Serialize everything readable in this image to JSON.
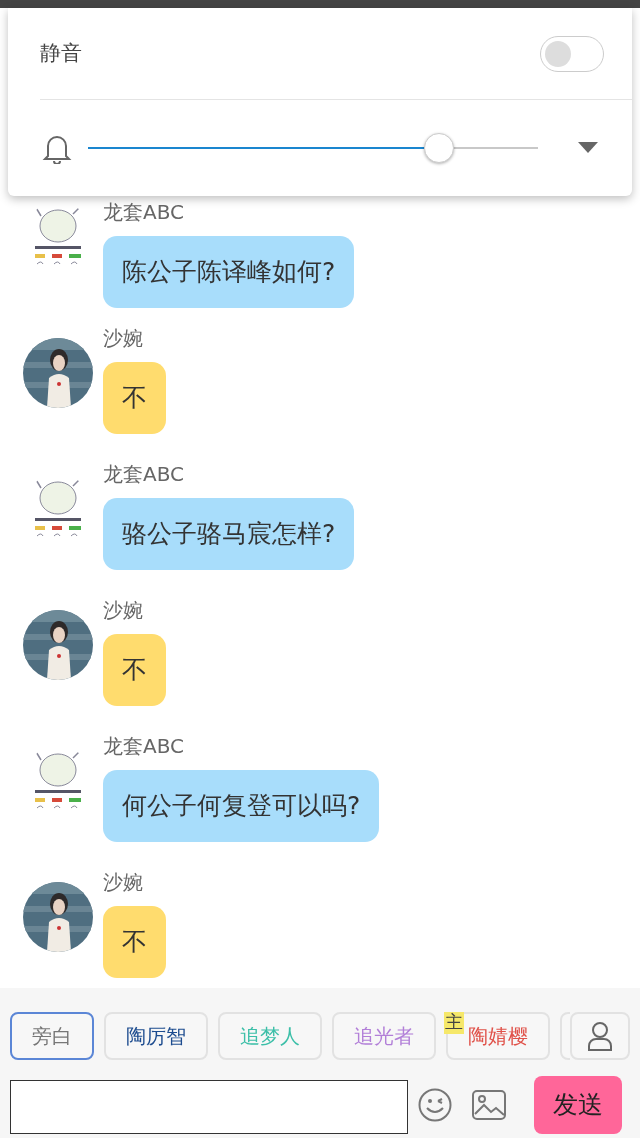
{
  "volume_panel": {
    "mute_label": "静音",
    "mute_on": false,
    "level": 0.78
  },
  "messages": [
    {
      "sender": "龙套ABC",
      "kind": "sketch",
      "text": "陈公子陈译峰如何?",
      "color": "#a8ddfb"
    },
    {
      "sender": "沙婉",
      "text": "不",
      "color": "#ffdc6e"
    },
    {
      "sender": "龙套ABC",
      "kind": "sketch",
      "text": "骆公子骆马宸怎样?",
      "color": "#a8ddfb"
    },
    {
      "sender": "沙婉",
      "text": "不",
      "color": "#ffdc6e"
    },
    {
      "sender": "龙套ABC",
      "kind": "sketch",
      "text": "何公子何复登可以吗?",
      "color": "#a8ddfb"
    },
    {
      "sender": "沙婉",
      "text": "不",
      "color": "#ffdc6e"
    }
  ],
  "characters": [
    {
      "label": "旁白",
      "color": "#777777",
      "selected": true
    },
    {
      "label": "陶厉智",
      "color": "#1d4c8f",
      "selected": false
    },
    {
      "label": "追梦人",
      "color": "#3cbfa8",
      "selected": false
    },
    {
      "label": "追光者",
      "color": "#b27fd8",
      "selected": false
    },
    {
      "label": "陶婧樱",
      "color": "#e0524a",
      "selected": false,
      "badge": "主"
    }
  ],
  "composer": {
    "send_label": "发送"
  }
}
